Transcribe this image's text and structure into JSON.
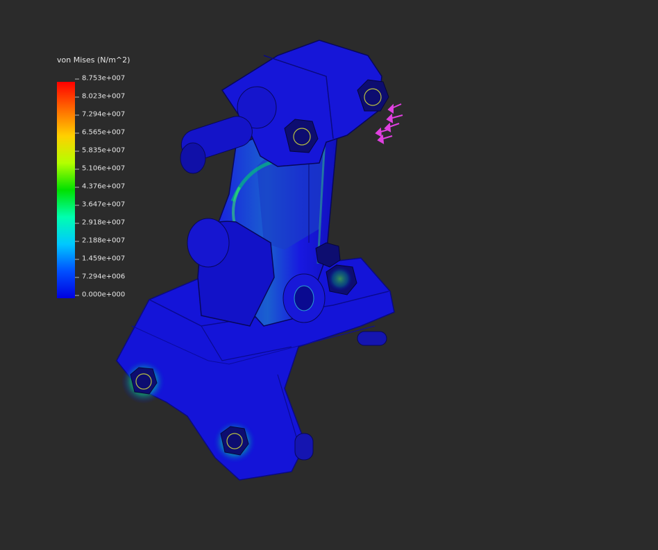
{
  "legend": {
    "title": "von Mises (N/m^2)",
    "ticks": [
      "8.753e+007",
      "8.023e+007",
      "7.294e+007",
      "6.565e+007",
      "5.835e+007",
      "5.106e+007",
      "4.376e+007",
      "3.647e+007",
      "2.918e+007",
      "2.188e+007",
      "1.459e+007",
      "7.294e+006",
      "0.000e+000"
    ]
  },
  "colors": {
    "background": "#2b2b2b",
    "part_base": "#1414d8",
    "part_dark": "#0a0a90",
    "stress_high": "#00e000",
    "load_arrows": "#e040e0"
  },
  "icons": [
    "load-arrow-icon"
  ]
}
